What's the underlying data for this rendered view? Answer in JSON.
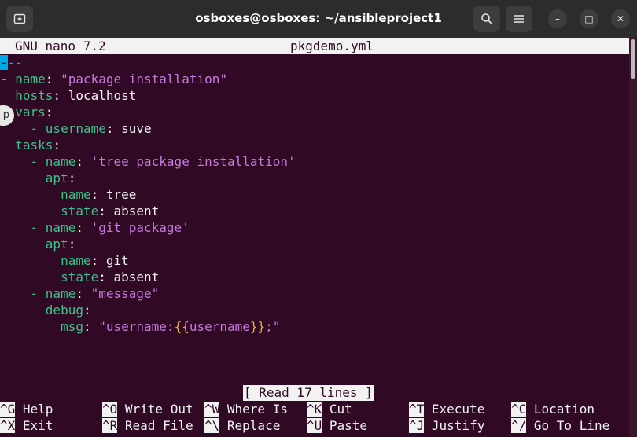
{
  "window": {
    "title": "osboxes@osboxes: ~/ansibleproject1",
    "new_tab_icon": "new-tab-icon",
    "search_icon": "search-icon",
    "menu_icon": "hamburger-menu-icon",
    "minimize_glyph": "–",
    "maximize_glyph": "□",
    "close_glyph": "✕"
  },
  "nano": {
    "version": "GNU nano 7.2",
    "filename": "pkgdemo.yml",
    "status": "[ Read 17 lines ]"
  },
  "file_lines": [
    "---",
    "- name: \"package installation\"",
    "  hosts: localhost",
    "  vars:",
    "    - username: suve",
    "  tasks:",
    "    - name: 'tree package installation'",
    "      apt:",
    "        name: tree",
    "        state: absent",
    "    - name: 'git package'",
    "      apt:",
    "        name: git",
    "        state: absent",
    "    - name: \"message\"",
    "      debug:",
    "        msg: \"username:{{username}};\""
  ],
  "shortcuts": [
    {
      "key": "^G",
      "label": "Help"
    },
    {
      "key": "^O",
      "label": "Write Out"
    },
    {
      "key": "^W",
      "label": "Where Is"
    },
    {
      "key": "^K",
      "label": "Cut"
    },
    {
      "key": "^T",
      "label": "Execute"
    },
    {
      "key": "^C",
      "label": "Location"
    },
    {
      "key": "^X",
      "label": "Exit"
    },
    {
      "key": "^R",
      "label": "Read File"
    },
    {
      "key": "^\\",
      "label": "Replace"
    },
    {
      "key": "^U",
      "label": "Paste"
    },
    {
      "key": "^J",
      "label": "Justify"
    },
    {
      "key": "^/",
      "label": "Go To Line"
    }
  ],
  "side_badge": "p",
  "colors": {
    "background": "#300a24",
    "key": "#3cc28b",
    "string": "#c678dd",
    "template": "#e5a852",
    "cursor": "#00a8e8"
  }
}
